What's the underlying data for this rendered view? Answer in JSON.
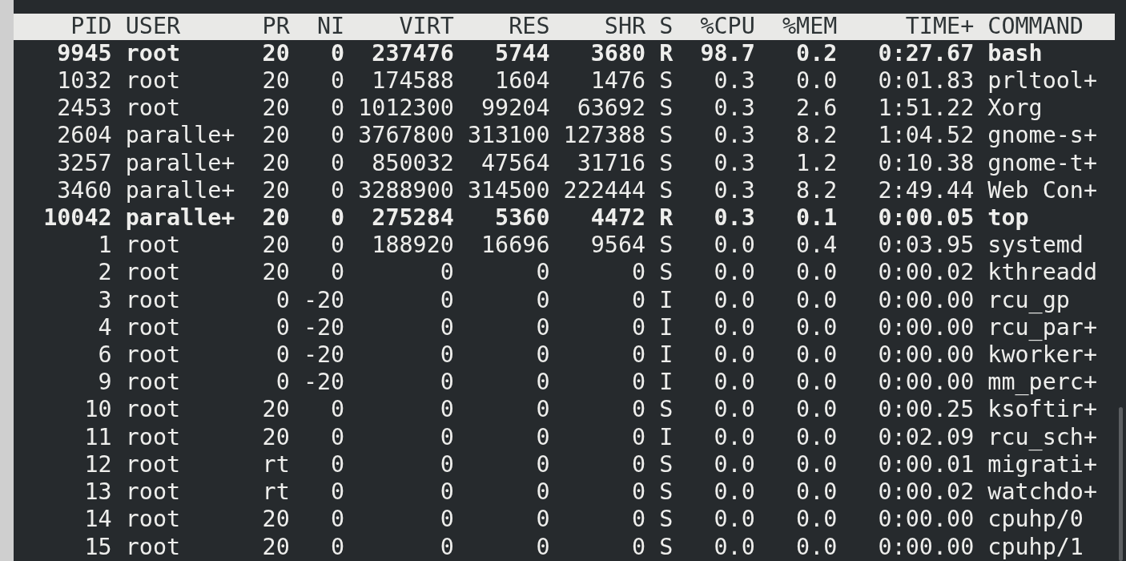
{
  "table": {
    "columns": [
      "PID",
      "USER",
      "PR",
      "NI",
      "VIRT",
      "RES",
      "SHR",
      "S",
      "%CPU",
      "%MEM",
      "TIME+",
      "COMMAND"
    ],
    "rows": [
      {
        "highlighted": true,
        "cells": [
          "9945",
          "root",
          "20",
          "0",
          "237476",
          "5744",
          "3680",
          "R",
          "98.7",
          "0.2",
          "0:27.67",
          "bash"
        ]
      },
      {
        "highlighted": false,
        "cells": [
          "1032",
          "root",
          "20",
          "0",
          "174588",
          "1604",
          "1476",
          "S",
          "0.3",
          "0.0",
          "0:01.83",
          "prltool+"
        ]
      },
      {
        "highlighted": false,
        "cells": [
          "2453",
          "root",
          "20",
          "0",
          "1012300",
          "99204",
          "63692",
          "S",
          "0.3",
          "2.6",
          "1:51.22",
          "Xorg"
        ]
      },
      {
        "highlighted": false,
        "cells": [
          "2604",
          "paralle+",
          "20",
          "0",
          "3767800",
          "313100",
          "127388",
          "S",
          "0.3",
          "8.2",
          "1:04.52",
          "gnome-s+"
        ]
      },
      {
        "highlighted": false,
        "cells": [
          "3257",
          "paralle+",
          "20",
          "0",
          "850032",
          "47564",
          "31716",
          "S",
          "0.3",
          "1.2",
          "0:10.38",
          "gnome-t+"
        ]
      },
      {
        "highlighted": false,
        "cells": [
          "3460",
          "paralle+",
          "20",
          "0",
          "3288900",
          "314500",
          "222444",
          "S",
          "0.3",
          "8.2",
          "2:49.44",
          "Web Con+"
        ]
      },
      {
        "highlighted": true,
        "cells": [
          "10042",
          "paralle+",
          "20",
          "0",
          "275284",
          "5360",
          "4472",
          "R",
          "0.3",
          "0.1",
          "0:00.05",
          "top"
        ]
      },
      {
        "highlighted": false,
        "cells": [
          "1",
          "root",
          "20",
          "0",
          "188920",
          "16696",
          "9564",
          "S",
          "0.0",
          "0.4",
          "0:03.95",
          "systemd"
        ]
      },
      {
        "highlighted": false,
        "cells": [
          "2",
          "root",
          "20",
          "0",
          "0",
          "0",
          "0",
          "S",
          "0.0",
          "0.0",
          "0:00.02",
          "kthreadd"
        ]
      },
      {
        "highlighted": false,
        "cells": [
          "3",
          "root",
          "0",
          "-20",
          "0",
          "0",
          "0",
          "I",
          "0.0",
          "0.0",
          "0:00.00",
          "rcu_gp"
        ]
      },
      {
        "highlighted": false,
        "cells": [
          "4",
          "root",
          "0",
          "-20",
          "0",
          "0",
          "0",
          "I",
          "0.0",
          "0.0",
          "0:00.00",
          "rcu_par+"
        ]
      },
      {
        "highlighted": false,
        "cells": [
          "6",
          "root",
          "0",
          "-20",
          "0",
          "0",
          "0",
          "I",
          "0.0",
          "0.0",
          "0:00.00",
          "kworker+"
        ]
      },
      {
        "highlighted": false,
        "cells": [
          "9",
          "root",
          "0",
          "-20",
          "0",
          "0",
          "0",
          "I",
          "0.0",
          "0.0",
          "0:00.00",
          "mm_perc+"
        ]
      },
      {
        "highlighted": false,
        "cells": [
          "10",
          "root",
          "20",
          "0",
          "0",
          "0",
          "0",
          "S",
          "0.0",
          "0.0",
          "0:00.25",
          "ksoftir+"
        ]
      },
      {
        "highlighted": false,
        "cells": [
          "11",
          "root",
          "20",
          "0",
          "0",
          "0",
          "0",
          "I",
          "0.0",
          "0.0",
          "0:02.09",
          "rcu_sch+"
        ]
      },
      {
        "highlighted": false,
        "cells": [
          "12",
          "root",
          "rt",
          "0",
          "0",
          "0",
          "0",
          "S",
          "0.0",
          "0.0",
          "0:00.01",
          "migrati+"
        ]
      },
      {
        "highlighted": false,
        "cells": [
          "13",
          "root",
          "rt",
          "0",
          "0",
          "0",
          "0",
          "S",
          "0.0",
          "0.0",
          "0:00.02",
          "watchdo+"
        ]
      },
      {
        "highlighted": false,
        "cells": [
          "14",
          "root",
          "20",
          "0",
          "0",
          "0",
          "0",
          "S",
          "0.0",
          "0.0",
          "0:00.00",
          "cpuhp/0"
        ]
      },
      {
        "highlighted": false,
        "cells": [
          "15",
          "root",
          "20",
          "0",
          "0",
          "0",
          "0",
          "S",
          "0.0",
          "0.0",
          "0:00.00",
          "cpuhp/1"
        ]
      }
    ]
  }
}
